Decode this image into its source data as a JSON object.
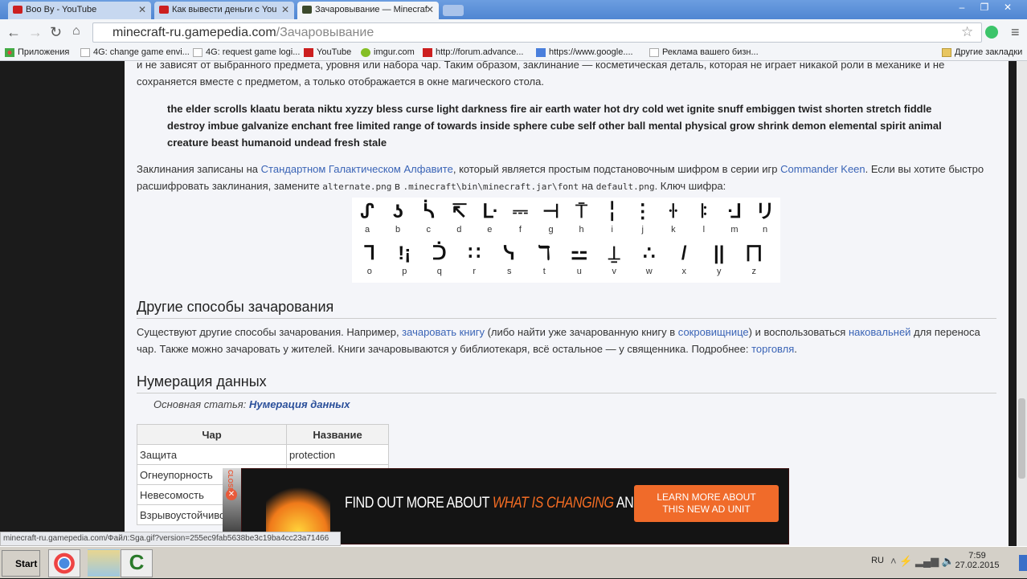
{
  "browser": {
    "tabs": [
      {
        "title": "Boo By - YouTube",
        "icon": "youtube-icon"
      },
      {
        "title": "Как вывести деньги с You",
        "icon": "youtube-icon"
      },
      {
        "title": "Зачаровывание — Minecraf",
        "icon": "minecraft-icon",
        "active": true
      }
    ],
    "url_host": "minecraft-ru.gamepedia.com",
    "url_path": "/Зачаровывание",
    "bookmarks": [
      "Приложения",
      "4G: change game envi...",
      "4G: request game logi...",
      "YouTube",
      "imgur.com",
      "http://forum.advance...",
      "https://www.google....",
      "Реклама вашего бизн..."
    ],
    "other_bookmarks": "Другие закладки"
  },
  "article": {
    "intro_line1": "и не зависят от выбранного предмета, уровня или набора чар. Таким образом, заклинание — косметическая деталь, которая не играет никакой роли в механике и не",
    "intro_line2": "сохраняется вместе с предметом, а только отображается в окне магического стола.",
    "words": "the elder scrolls klaatu berata niktu xyzzy bless curse light darkness fire air earth water hot dry cold wet ignite snuff embiggen twist shorten stretch fiddle destroy imbue galvanize enchant free limited range of towards inside sphere cube self other ball mental physical grow shrink demon elemental spirit animal creature beast humanoid undead fresh stale",
    "cipher_p": {
      "t1": "Заклинания записаны на ",
      "l1": "Стандартном Галактическом Алфавите",
      "t2": ", который является простым подстановочным шифром в серии игр ",
      "l2": "Commander Keen",
      "t3": ". Если вы хотите быстро расшифровать заклинания, замените ",
      "c1": "alternate.png",
      "t4": " в ",
      "c2": ".minecraft\\bin\\minecraft.jar\\font",
      "t5": " на ",
      "c3": "default.png",
      "t6": ". Ключ шифра:"
    },
    "cipher_key": [
      {
        "g": "ᔑ",
        "l": "a"
      },
      {
        "g": "ʖ",
        "l": "b"
      },
      {
        "g": "ᓵ",
        "l": "c"
      },
      {
        "g": "↸",
        "l": "d"
      },
      {
        "g": "ᒷ",
        "l": "e"
      },
      {
        "g": "⎓",
        "l": "f"
      },
      {
        "g": "⊣",
        "l": "g"
      },
      {
        "g": "⍑",
        "l": "h"
      },
      {
        "g": "╎",
        "l": "i"
      },
      {
        "g": "⋮",
        "l": "j"
      },
      {
        "g": "ꖌ",
        "l": "k"
      },
      {
        "g": "ꖎ",
        "l": "l"
      },
      {
        "g": "ᒲ",
        "l": "m"
      },
      {
        "g": "リ",
        "l": "n"
      },
      {
        "g": "ᒣ",
        "l": "o"
      },
      {
        "g": "!¡",
        "l": "p"
      },
      {
        "g": "ᑑ",
        "l": "q"
      },
      {
        "g": "∷",
        "l": "r"
      },
      {
        "g": "ᓭ",
        "l": "s"
      },
      {
        "g": "ℸ",
        "l": "t"
      },
      {
        "g": "⚍",
        "l": "u"
      },
      {
        "g": "⍊",
        "l": "v"
      },
      {
        "g": "∴",
        "l": "w"
      },
      {
        "g": "/",
        "l": "x"
      },
      {
        "g": "||",
        "l": "y"
      },
      {
        "g": "⨅",
        "l": "z"
      }
    ],
    "h_other": "Другие способы зачарования",
    "other_p": {
      "t1": "Существуют другие способы зачарования. Например, ",
      "l1": "зачаровать книгу",
      "t2": " (либо найти уже зачарованную книгу в ",
      "l2": "сокровищнице",
      "t3": ") и воспользоваться ",
      "l3": "наковальней",
      "t4": " для переноса чар. Также можно зачаровать у жителей. Книги зачаровываются у библиотекаря, всё остальное — у священника. Подробнее: ",
      "l4": "торговля",
      "t5": "."
    },
    "h_ids": "Нумерация данных",
    "main_article_label": "Основная статья: ",
    "main_article_link": "Нумерация данных",
    "table": {
      "headers": [
        "Чар",
        "Название"
      ],
      "rows": [
        [
          "Защита",
          "protection"
        ],
        [
          "Огнеупорность",
          ""
        ],
        [
          "Невесомость",
          ""
        ],
        [
          "Взрывоустойчивость",
          ""
        ]
      ]
    }
  },
  "ad": {
    "close": "CLOSE",
    "text1": "FIND OUT MORE ABOUT ",
    "text2": "WHAT IS CHANGING",
    "text3": " AND WHY",
    "button1": "LEARN MORE ABOUT",
    "button2": "THIS NEW AD UNIT"
  },
  "status_url": "minecraft-ru.gamepedia.com/Файл:Sga.gif?version=255ec9fab5638be3c19ba4cc23a71466",
  "taskbar": {
    "start": "Start",
    "lang": "RU",
    "time": "7:59",
    "date": "27.02.2015"
  }
}
